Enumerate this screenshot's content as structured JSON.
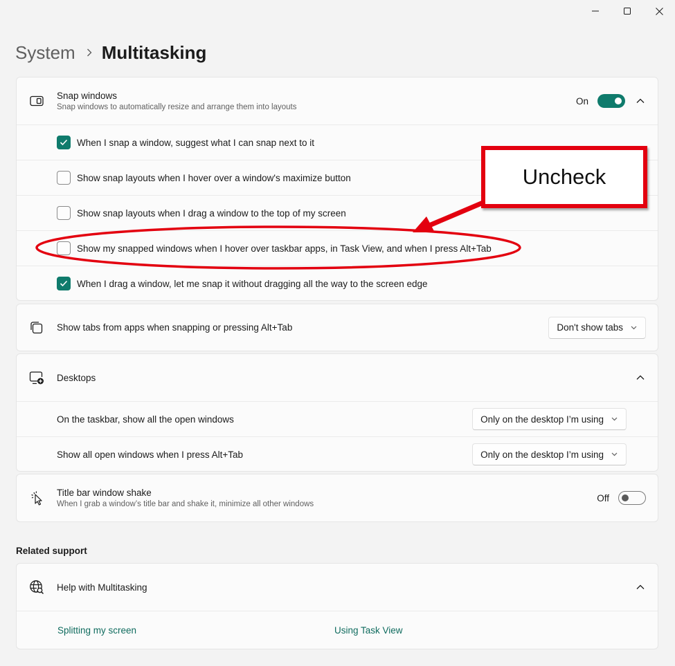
{
  "window_controls": {
    "minimize": "minimize-icon",
    "maximize": "maximize-icon",
    "close": "close-icon"
  },
  "breadcrumb": {
    "parent": "System",
    "current": "Multitasking"
  },
  "snap_windows": {
    "title": "Snap windows",
    "description": "Snap windows to automatically resize and arrange them into layouts",
    "toggle_state": "On",
    "toggle_on": true,
    "expanded": true,
    "options": [
      {
        "label": "When I snap a window, suggest what I can snap next to it",
        "checked": true
      },
      {
        "label": "Show snap layouts when I hover over a window's maximize button",
        "checked": false
      },
      {
        "label": "Show snap layouts when I drag a window to the top of my screen",
        "checked": false
      },
      {
        "label": "Show my snapped windows when I hover over taskbar apps, in Task View, and when I press Alt+Tab",
        "checked": false
      },
      {
        "label": "When I drag a window, let me snap it without dragging all the way to the screen edge",
        "checked": true
      }
    ]
  },
  "tabs_setting": {
    "label": "Show tabs from apps when snapping or pressing Alt+Tab",
    "value": "Don't show tabs"
  },
  "desktops": {
    "title": "Desktops",
    "expanded": true,
    "rows": [
      {
        "label": "On the taskbar, show all the open windows",
        "value": "Only on the desktop I’m using"
      },
      {
        "label": "Show all open windows when I press Alt+Tab",
        "value": "Only on the desktop I’m using"
      }
    ]
  },
  "shake": {
    "title": "Title bar window shake",
    "description": "When I grab a window’s title bar and shake it, minimize all other windows",
    "toggle_state": "Off",
    "toggle_on": false
  },
  "related": {
    "heading": "Related support",
    "help_title": "Help with Multitasking",
    "links": [
      "Splitting my screen",
      "Using Task View"
    ]
  },
  "annotation": {
    "text": "Uncheck",
    "color": "#e3000f"
  },
  "colors": {
    "accent": "#0f7b6c",
    "link": "#0f6b5e",
    "annotation": "#e3000f"
  }
}
